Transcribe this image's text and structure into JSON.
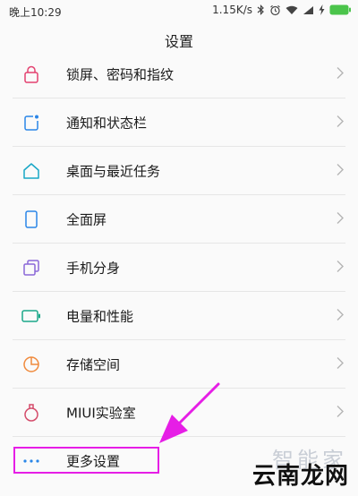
{
  "status_bar": {
    "time": "晚上10:29",
    "network_speed": "1.15K/s"
  },
  "header": {
    "title": "设置"
  },
  "settings": {
    "items": [
      {
        "label": "锁屏、密码和指纹",
        "icon": "lock-icon",
        "color": "#e3416f"
      },
      {
        "label": "通知和状态栏",
        "icon": "notification-icon",
        "color": "#2a86e8"
      },
      {
        "label": "桌面与最近任务",
        "icon": "home-icon",
        "color": "#19a7c6"
      },
      {
        "label": "全面屏",
        "icon": "fullscreen-phone-icon",
        "color": "#2a86e8"
      },
      {
        "label": "手机分身",
        "icon": "second-space-icon",
        "color": "#8a67d8"
      },
      {
        "label": "电量和性能",
        "icon": "battery-icon",
        "color": "#1ba889"
      },
      {
        "label": "存储空间",
        "icon": "storage-pie-icon",
        "color": "#f08a3c"
      },
      {
        "label": "MIUI实验室",
        "icon": "lab-flask-icon",
        "color": "#d44b6a"
      },
      {
        "label": "更多设置",
        "icon": "more-dots-icon",
        "color": "#2a86e8"
      }
    ]
  },
  "annotation": {
    "highlight_color": "#e61ee6"
  },
  "watermark": {
    "top_text": "智能家",
    "bottom_text": "云南龙网"
  }
}
